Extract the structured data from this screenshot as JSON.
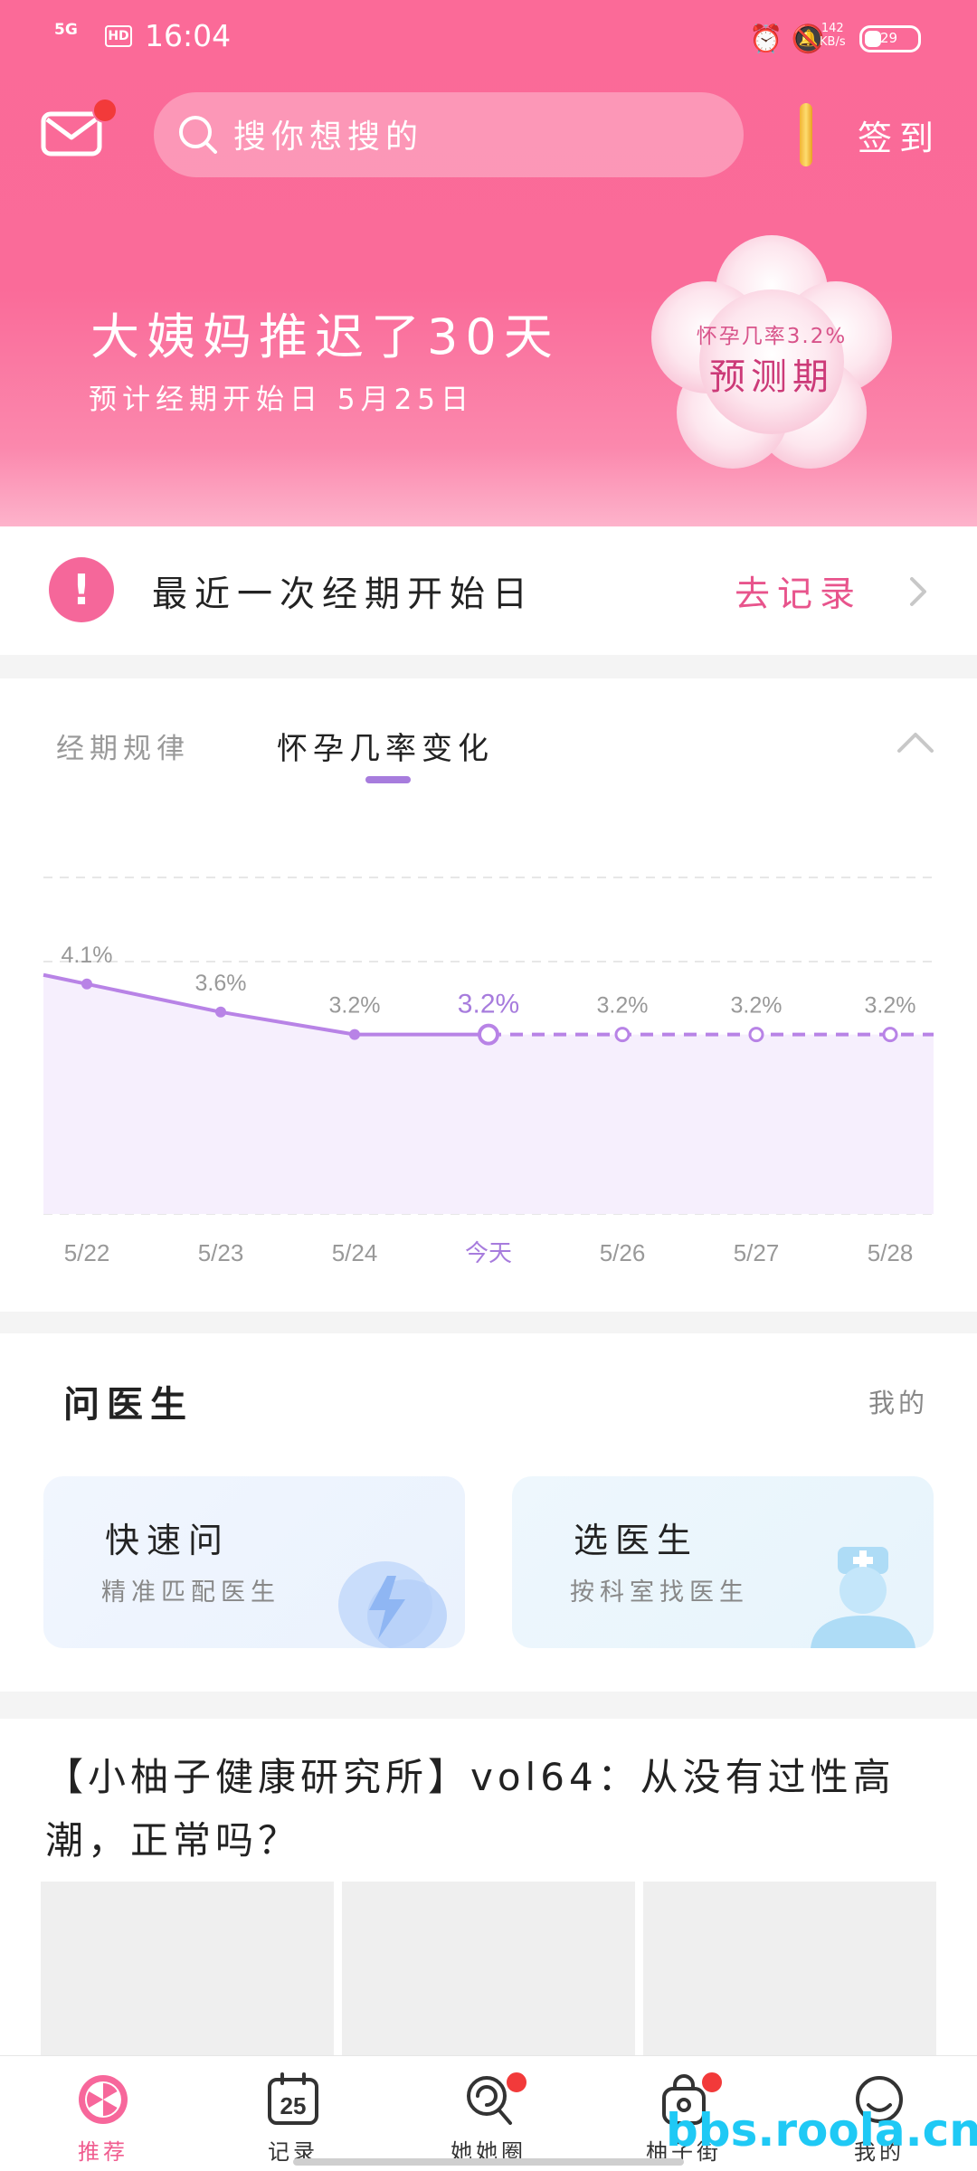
{
  "status_bar": {
    "network": "5G",
    "hd": "HD",
    "time": "16:04",
    "speed_value": "142",
    "speed_unit": "KB/s",
    "battery": "29"
  },
  "header": {
    "search_placeholder": "搜你想搜的",
    "signin_label": "签到",
    "delay_title": "大姨妈推迟了30天",
    "expected_start": "预计经期开始日 5月25日",
    "flower_rate": "怀孕几率3.2%",
    "flower_period": "预测期"
  },
  "last_period": {
    "label": "最近一次经期开始日",
    "action": "去记录"
  },
  "chart_tabs": {
    "tab1": "经期规律",
    "tab2": "怀孕几率变化"
  },
  "chart_data": {
    "type": "line",
    "categories": [
      "5/22",
      "5/23",
      "5/24",
      "今天",
      "5/26",
      "5/27",
      "5/28"
    ],
    "value_labels": [
      "4.1%",
      "3.6%",
      "3.2%",
      "3.2%",
      "3.2%",
      "3.2%",
      "3.2%"
    ],
    "series": [
      {
        "values": [
          4.1,
          3.6,
          3.2,
          3.2,
          3.2,
          3.2,
          3.2
        ]
      }
    ],
    "today_index": 3,
    "actual_until_index": 3,
    "ylim": [
      0,
      6
    ],
    "grid": true,
    "colors": {
      "line": "#b883e6",
      "fill": "#f6effd",
      "today": "#a77cdd",
      "label": "#999999"
    }
  },
  "doctor": {
    "title": "问医生",
    "mine": "我的",
    "quick": {
      "title": "快速问",
      "subtitle": "精准匹配医生"
    },
    "choose": {
      "title": "选医生",
      "subtitle": "按科室找医生"
    }
  },
  "article": {
    "title": "【小柚子健康研究所】vol64：从没有过性高潮，正常吗？"
  },
  "nav": [
    {
      "label": "推荐",
      "icon": "grapefruit-icon"
    },
    {
      "label": "记录",
      "icon": "calendar-icon",
      "date": "25"
    },
    {
      "label": "她她圈",
      "icon": "lollipop-icon"
    },
    {
      "label": "柚子街",
      "icon": "shopping-bag-icon"
    },
    {
      "label": "我的",
      "icon": "profile-icon"
    }
  ],
  "watermark": "bbs.roola.cn",
  "colors": {
    "brand_pink": "#fa6b99",
    "accent_purple": "#a77cdd",
    "badge_red": "#f23a3a"
  }
}
